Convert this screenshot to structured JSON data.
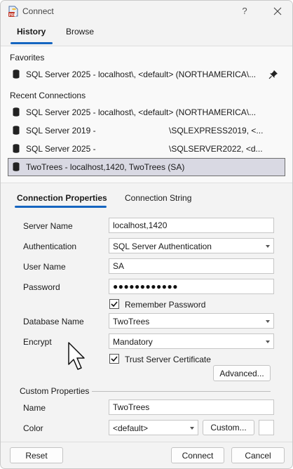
{
  "window": {
    "title": "Connect",
    "help_label": "?",
    "icons": {
      "app": "ssms-app-icon",
      "close": "close-icon"
    }
  },
  "top_tabs": [
    {
      "label": "History",
      "active": true
    },
    {
      "label": "Browse",
      "active": false
    }
  ],
  "history": {
    "favorites_label": "Favorites",
    "favorites": [
      {
        "text": "SQL Server 2025 - localhost\\, <default> (NORTHAMERICA\\...",
        "pinned": true
      }
    ],
    "recent_label": "Recent Connections",
    "recent": [
      {
        "text": "SQL Server 2025 - localhost\\, <default> (NORTHAMERICA\\...",
        "text2": ""
      },
      {
        "text": "SQL Server 2019 -",
        "text2": "\\SQLEXPRESS2019, <..."
      },
      {
        "text": "SQL Server 2025 -",
        "text2": "\\SQLSERVER2022, <d..."
      },
      {
        "text": "TwoTrees - localhost,1420, TwoTrees (SA)",
        "text2": "",
        "selected": true
      }
    ]
  },
  "props_tabs": [
    {
      "label": "Connection Properties",
      "active": true
    },
    {
      "label": "Connection String",
      "active": false
    }
  ],
  "form": {
    "server_name_label": "Server Name",
    "server_name_value": "localhost,1420",
    "authentication_label": "Authentication",
    "authentication_value": "SQL Server Authentication",
    "user_name_label": "User Name",
    "user_name_value": "SA",
    "password_label": "Password",
    "password_mask": "●●●●●●●●●●●●",
    "remember_password_label": "Remember Password",
    "remember_password_checked": true,
    "database_name_label": "Database Name",
    "database_name_value": "TwoTrees",
    "encrypt_label": "Encrypt",
    "encrypt_value": "Mandatory",
    "trust_cert_label": "Trust Server Certificate",
    "trust_cert_checked": true,
    "advanced_button": "Advanced..."
  },
  "custom": {
    "section_label": "Custom Properties",
    "name_label": "Name",
    "name_value": "TwoTrees",
    "color_label": "Color",
    "color_value": "<default>",
    "custom_button": "Custom..."
  },
  "footer": {
    "reset_button": "Reset",
    "connect_button": "Connect",
    "cancel_button": "Cancel"
  },
  "colors": {
    "accent": "#1565c0",
    "selected_row_bg": "#d9d9e3",
    "window_bg": "#f3f3f3"
  }
}
